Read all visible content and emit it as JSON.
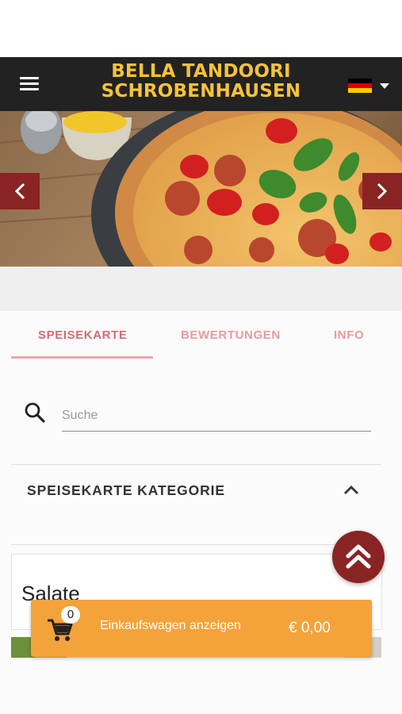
{
  "header": {
    "brand_line1": "BELLA TANDOORI",
    "brand_line2": "SCHROBENHAUSEN",
    "menu_icon": "hamburger-menu-icon",
    "language_flag": "germany-flag-icon"
  },
  "hero": {
    "image": "pizza-photo",
    "prev_icon": "chevron-left-icon",
    "next_icon": "chevron-right-icon"
  },
  "tabs": [
    {
      "label": "SPEISEKARTE",
      "active": true
    },
    {
      "label": "BEWERTUNGEN",
      "active": false
    },
    {
      "label": "INFO",
      "active": false
    }
  ],
  "search": {
    "placeholder": "Suche",
    "value": ""
  },
  "category": {
    "title": "SPEISEKARTE KATEGORIE",
    "toggle_icon": "chevron-up-icon"
  },
  "section": {
    "title": "Salate"
  },
  "cart": {
    "count": "0",
    "label": "Einkaufswagen anzeigen",
    "total": "€ 0,00",
    "icon": "shopping-cart-icon"
  },
  "scroll_top": {
    "icon": "double-chevron-up-icon"
  },
  "colors": {
    "header_bg": "#222222",
    "brand_text": "#f6c23a",
    "accent_red": "#8a2424",
    "tab_text": "#e79aa0",
    "cart_bar": "#f4a23a"
  }
}
